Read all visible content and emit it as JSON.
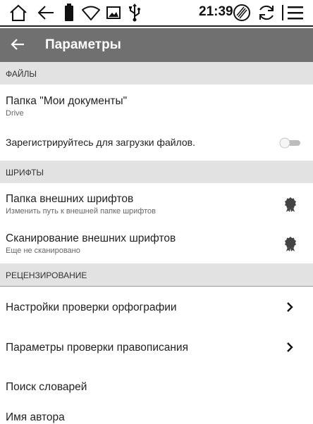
{
  "status_bar": {
    "time": "21:39",
    "icons": [
      "home-icon",
      "back-arrow-icon",
      "battery-icon",
      "wifi-icon",
      "image-icon",
      "usb-icon",
      "cleaner-icon",
      "sync-icon",
      "menu-icon"
    ]
  },
  "app_bar": {
    "title": "Параметры"
  },
  "sections": {
    "files": "ФАЙЛЫ",
    "fonts": "ШРИФТЫ",
    "review": "РЕЦЕНЗИРОВАНИЕ"
  },
  "files": {
    "folder_title": "Папка \"Мои документы\"",
    "folder_sub": "Drive",
    "register_label": "Зарегистрируйтесь для загрузки файлов.",
    "register_toggle_on": false
  },
  "fonts": {
    "ext_folder_title": "Папка внешних шрифтов",
    "ext_folder_sub": "Изменить путь к внешней папке шрифтов",
    "scan_title": "Сканирование внешних шрифтов",
    "scan_sub": "Еще не сканировано"
  },
  "review": {
    "spelling": "Настройки проверки орфографии",
    "grammar": "Параметры проверки правописания",
    "dictionaries": "Поиск словарей",
    "author": "Имя автора"
  }
}
